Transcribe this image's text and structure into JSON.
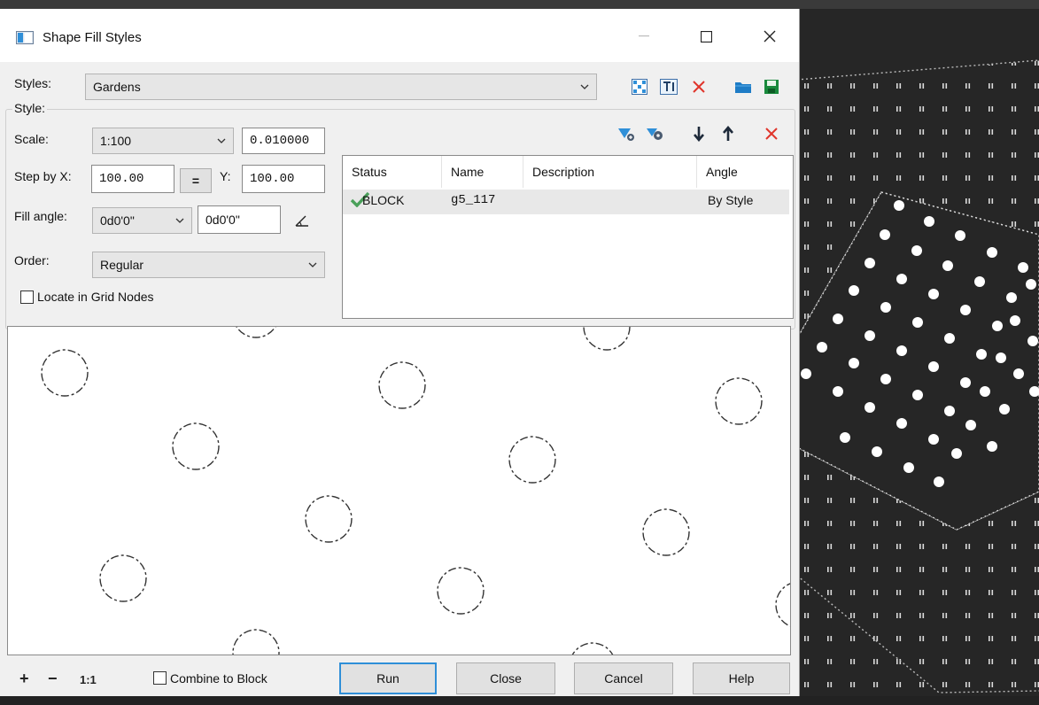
{
  "window": {
    "title": "Shape Fill Styles",
    "minimize_icon": "minimize-icon",
    "maximize_icon": "maximize-icon",
    "close_icon": "close-icon"
  },
  "styles_row": {
    "label": "Styles:",
    "value": "Gardens",
    "icons": [
      "pattern-icon",
      "text-style-icon",
      "delete-icon",
      "open-folder-icon",
      "save-icon"
    ]
  },
  "style_group": {
    "label": "Style:",
    "scale_label": "Scale:",
    "scale_value": "1:100",
    "scale_factor": "0.010000",
    "step_label": "Step by X:",
    "step_x": "100.00",
    "equal_label": "=",
    "y_label": "Y:",
    "step_y": "100.00",
    "fill_angle_label": "Fill angle:",
    "fill_angle_value": "0d0'0\"",
    "fill_angle_field": "0d0'0\"",
    "order_label": "Order:",
    "order_value": "Regular",
    "locate_label": "Locate in Grid Nodes",
    "locate_checked": false
  },
  "list_toolbar": {
    "icons": [
      "add-block-icon",
      "block-settings-icon",
      "move-down-icon",
      "move-up-icon",
      "remove-icon"
    ]
  },
  "block_list": {
    "columns": [
      "Status",
      "Name",
      "Description",
      "Angle"
    ],
    "rows": [
      {
        "status": "BLOCK",
        "name": "g5_117",
        "description": "",
        "angle": "By Style"
      }
    ]
  },
  "footer": {
    "zoom_in": "+",
    "zoom_out": "−",
    "zoom_reset": "1:1",
    "combine_label": "Combine to Block",
    "combine_checked": false,
    "run_label": "Run",
    "close_label": "Close",
    "cancel_label": "Cancel",
    "help_label": "Help"
  },
  "colors": {
    "accent": "#2f8fd8",
    "delete": "#e0352b",
    "check": "#4aa05a",
    "cad_background": "#262626"
  }
}
